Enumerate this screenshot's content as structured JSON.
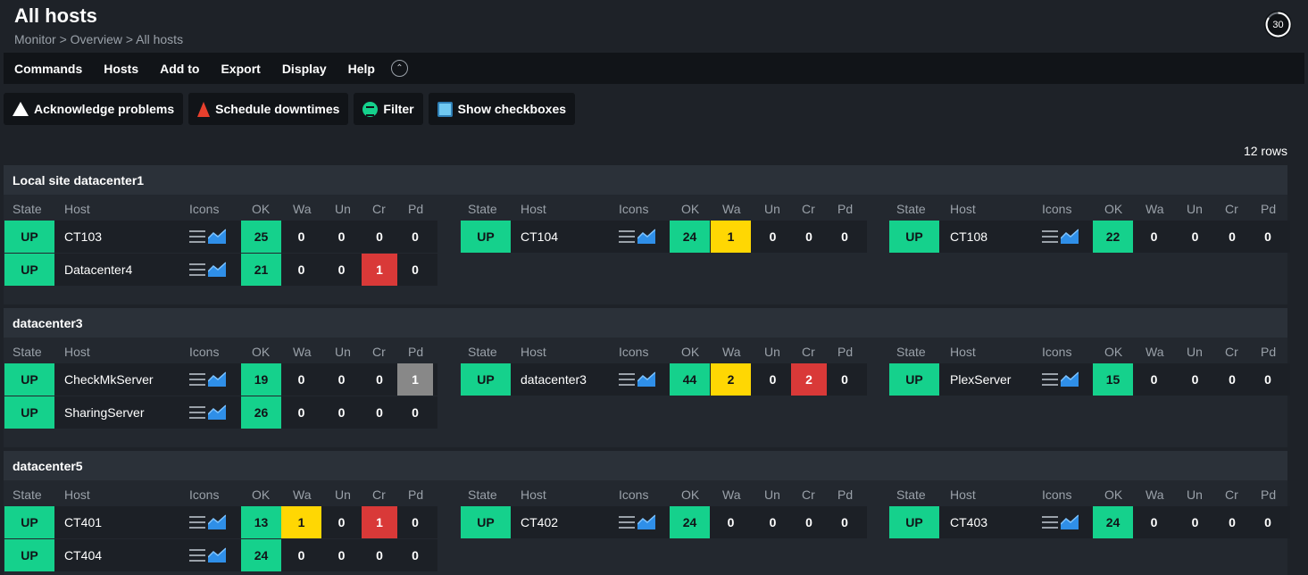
{
  "page": {
    "title": "All hosts",
    "breadcrumb": "Monitor > Overview > All hosts",
    "reload_interval": "30"
  },
  "menu": [
    "Commands",
    "Hosts",
    "Add to",
    "Export",
    "Display",
    "Help"
  ],
  "toolbar": {
    "acknowledge": "Acknowledge problems",
    "downtimes": "Schedule downtimes",
    "filter": "Filter",
    "checkboxes": "Show checkboxes"
  },
  "rows_count": "12 rows",
  "columns": [
    "State",
    "Host",
    "Icons",
    "OK",
    "Wa",
    "Un",
    "Cr",
    "Pd"
  ],
  "colors": {
    "ok": "#15d18c",
    "warn": "#ffd703",
    "crit": "#d93938",
    "pending": "#888888"
  },
  "groups": [
    {
      "title": "Local site datacenter1",
      "hosts": [
        {
          "state": "UP",
          "name": "CT103",
          "ok": "25",
          "wa": "0",
          "un": "0",
          "cr": "0",
          "pd": "0"
        },
        {
          "state": "UP",
          "name": "CT104",
          "ok": "24",
          "wa": "1",
          "un": "0",
          "cr": "0",
          "pd": "0"
        },
        {
          "state": "UP",
          "name": "CT108",
          "ok": "22",
          "wa": "0",
          "un": "0",
          "cr": "0",
          "pd": "0"
        },
        {
          "state": "UP",
          "name": "Datacenter4",
          "ok": "21",
          "wa": "0",
          "un": "0",
          "cr": "1",
          "pd": "0"
        }
      ]
    },
    {
      "title": "datacenter3",
      "hosts": [
        {
          "state": "UP",
          "name": "CheckMkServer",
          "ok": "19",
          "wa": "0",
          "un": "0",
          "cr": "0",
          "pd": "1"
        },
        {
          "state": "UP",
          "name": "datacenter3",
          "ok": "44",
          "wa": "2",
          "un": "0",
          "cr": "2",
          "pd": "0"
        },
        {
          "state": "UP",
          "name": "PlexServer",
          "ok": "15",
          "wa": "0",
          "un": "0",
          "cr": "0",
          "pd": "0"
        },
        {
          "state": "UP",
          "name": "SharingServer",
          "ok": "26",
          "wa": "0",
          "un": "0",
          "cr": "0",
          "pd": "0"
        }
      ]
    },
    {
      "title": "datacenter5",
      "hosts": [
        {
          "state": "UP",
          "name": "CT401",
          "ok": "13",
          "wa": "1",
          "un": "0",
          "cr": "1",
          "pd": "0"
        },
        {
          "state": "UP",
          "name": "CT402",
          "ok": "24",
          "wa": "0",
          "un": "0",
          "cr": "0",
          "pd": "0"
        },
        {
          "state": "UP",
          "name": "CT403",
          "ok": "24",
          "wa": "0",
          "un": "0",
          "cr": "0",
          "pd": "0"
        },
        {
          "state": "UP",
          "name": "CT404",
          "ok": "24",
          "wa": "0",
          "un": "0",
          "cr": "0",
          "pd": "0"
        }
      ]
    }
  ]
}
